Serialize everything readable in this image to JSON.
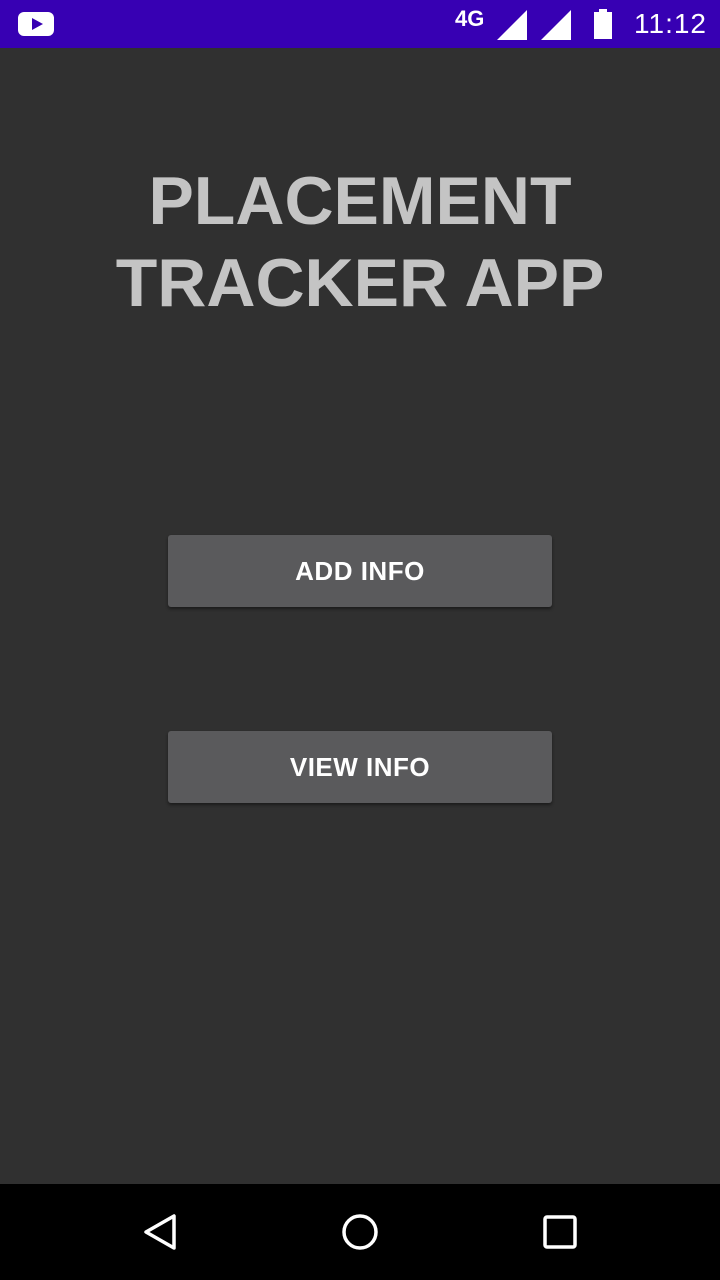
{
  "status_bar": {
    "background": "#3700b3",
    "network_type": "4G",
    "time": "11:12",
    "icons": [
      "youtube-icon",
      "signal-icon",
      "signal-icon",
      "battery-icon"
    ]
  },
  "main": {
    "background": "#303030",
    "title_line1": "PLACEMENT",
    "title_line2": "TRACKER APP",
    "buttons": [
      {
        "label": "ADD INFO"
      },
      {
        "label": "VIEW INFO"
      }
    ]
  },
  "nav_bar": {
    "icons": [
      "back-icon",
      "home-icon",
      "recents-icon"
    ]
  }
}
